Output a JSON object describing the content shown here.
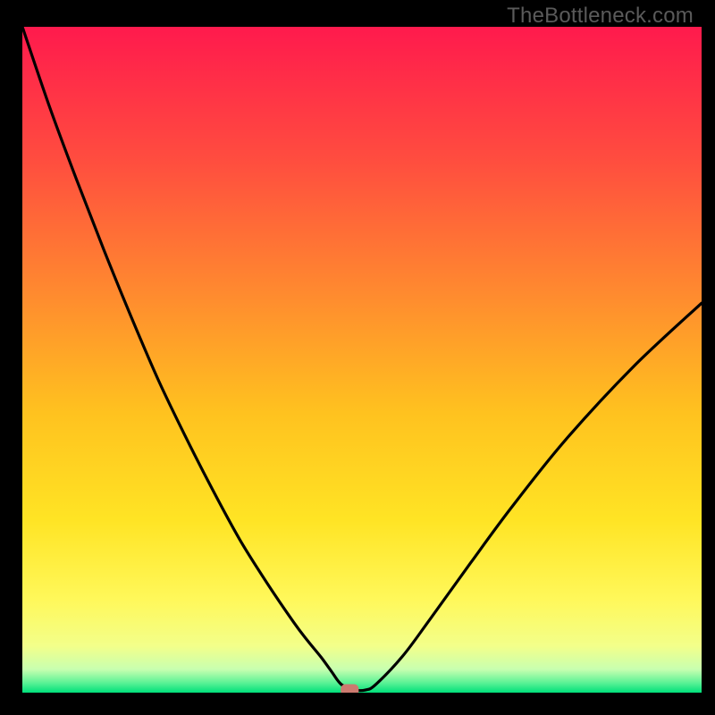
{
  "watermark": "TheBottleneck.com",
  "chart_data": {
    "type": "line",
    "title": "",
    "xlabel": "",
    "ylabel": "",
    "xlim": [
      0,
      100
    ],
    "ylim": [
      0,
      100
    ],
    "series": [
      {
        "name": "curve",
        "x": [
          0,
          4,
          8,
          12,
          16,
          20,
          24,
          28,
          32,
          36,
          40,
          42,
          44,
          45.5,
          47,
          49,
          50.5,
          52,
          56,
          60,
          66,
          72,
          80,
          90,
          100
        ],
        "y": [
          100,
          88,
          77,
          66.5,
          56.5,
          47,
          38.5,
          30.5,
          23,
          16.5,
          10.5,
          7.8,
          5.3,
          3.2,
          1.2,
          0.4,
          0.4,
          1.2,
          5.5,
          11,
          19.5,
          27.8,
          38,
          49,
          58.5
        ]
      }
    ],
    "marker": {
      "x": 48.2,
      "y": 0.4
    },
    "gradient_stops": [
      {
        "offset": 0.0,
        "color": "#ff1a4d"
      },
      {
        "offset": 0.2,
        "color": "#ff4d3f"
      },
      {
        "offset": 0.4,
        "color": "#ff8a2f"
      },
      {
        "offset": 0.58,
        "color": "#ffc21f"
      },
      {
        "offset": 0.74,
        "color": "#ffe424"
      },
      {
        "offset": 0.86,
        "color": "#fff85a"
      },
      {
        "offset": 0.93,
        "color": "#f3ff8a"
      },
      {
        "offset": 0.965,
        "color": "#c8ffb0"
      },
      {
        "offset": 0.985,
        "color": "#5cf296"
      },
      {
        "offset": 1.0,
        "color": "#00e07a"
      }
    ]
  }
}
